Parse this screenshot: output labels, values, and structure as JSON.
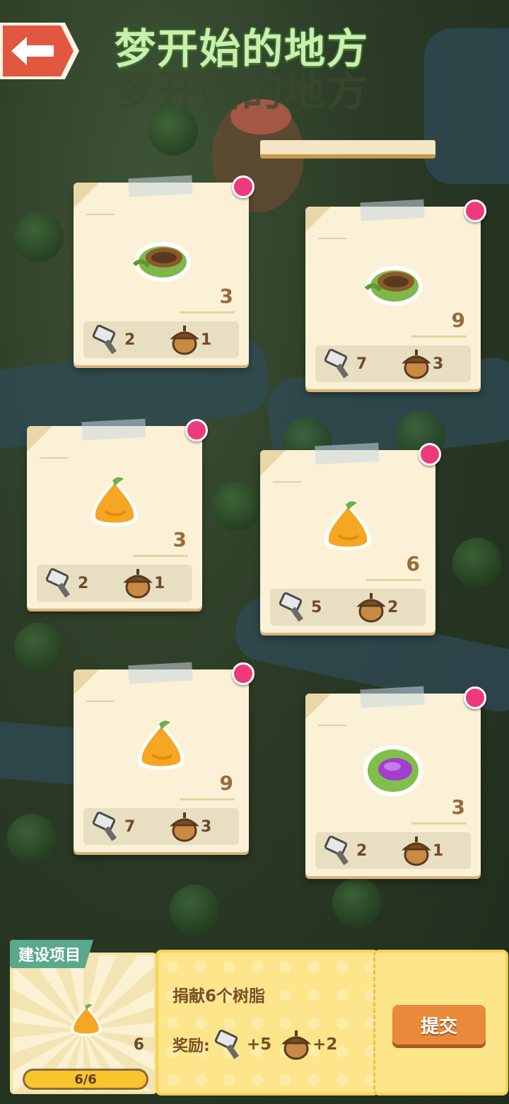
{
  "header": {
    "title": "梦开始的地方",
    "back_icon": "back-arrow-icon"
  },
  "cards": [
    {
      "item": "nest",
      "icon": "nest-icon",
      "quantity": "3",
      "hammer": "2",
      "acorn": "1"
    },
    {
      "item": "nest",
      "icon": "nest-icon",
      "quantity": "9",
      "hammer": "7",
      "acorn": "3"
    },
    {
      "item": "resin",
      "icon": "resin-icon",
      "quantity": "3",
      "hammer": "2",
      "acorn": "1"
    },
    {
      "item": "resin",
      "icon": "resin-icon",
      "quantity": "6",
      "hammer": "5",
      "acorn": "2"
    },
    {
      "item": "resin",
      "icon": "resin-icon",
      "quantity": "9",
      "hammer": "7",
      "acorn": "3"
    },
    {
      "item": "leaf-egg",
      "icon": "leaf-egg-icon",
      "quantity": "3",
      "hammer": "2",
      "acorn": "1"
    }
  ],
  "project": {
    "tag": "建设项目",
    "count": "6",
    "progress_text": "6/6",
    "progress": 1.0,
    "task_desc": "捐献6个树脂",
    "reward_label": "奖励:",
    "reward_hammer": "+5",
    "reward_acorn": "+2",
    "submit_label": "提交"
  },
  "colors": {
    "accent": "#e2573f",
    "pin": "#ee3a7b",
    "panel": "#fce58a",
    "button": "#e88a3a"
  }
}
